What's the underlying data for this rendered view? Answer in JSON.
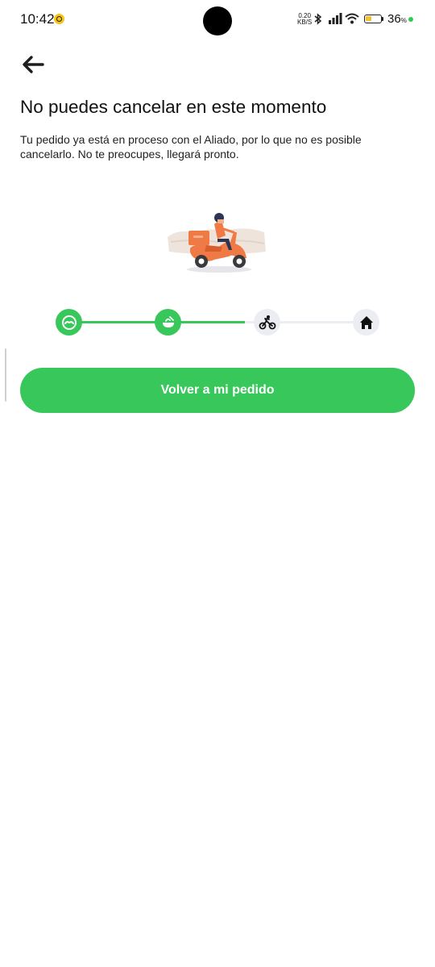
{
  "status_bar": {
    "time": "10:42",
    "net_speed_value": "0.20",
    "net_speed_unit": "KB/S",
    "battery_percent": "36",
    "battery_percent_sign": "%",
    "icons": [
      "notification-dot-icon",
      "bluetooth-icon",
      "signal-icon",
      "wifi-icon",
      "battery-icon"
    ]
  },
  "header": {
    "back_icon": "arrow-left-icon"
  },
  "main": {
    "title": "No puedes cancelar en este momento",
    "description": "Tu pedido ya está en proceso con el Aliado, por lo que no es posible cancelarlo. No te preocupes, llegará pronto.",
    "illustration": "delivery-scooter-illustration",
    "progress": {
      "completed_steps": 2,
      "total_steps": 4,
      "steps": [
        {
          "icon": "store-icon",
          "status": "done"
        },
        {
          "icon": "food-bowl-icon",
          "status": "done"
        },
        {
          "icon": "cyclist-icon",
          "status": "pending"
        },
        {
          "icon": "home-icon",
          "status": "pending"
        }
      ]
    },
    "primary_button": "Volver a mi pedido"
  },
  "colors": {
    "accent": "#37c75a",
    "pending": "#ecedf2",
    "text": "#111111"
  }
}
